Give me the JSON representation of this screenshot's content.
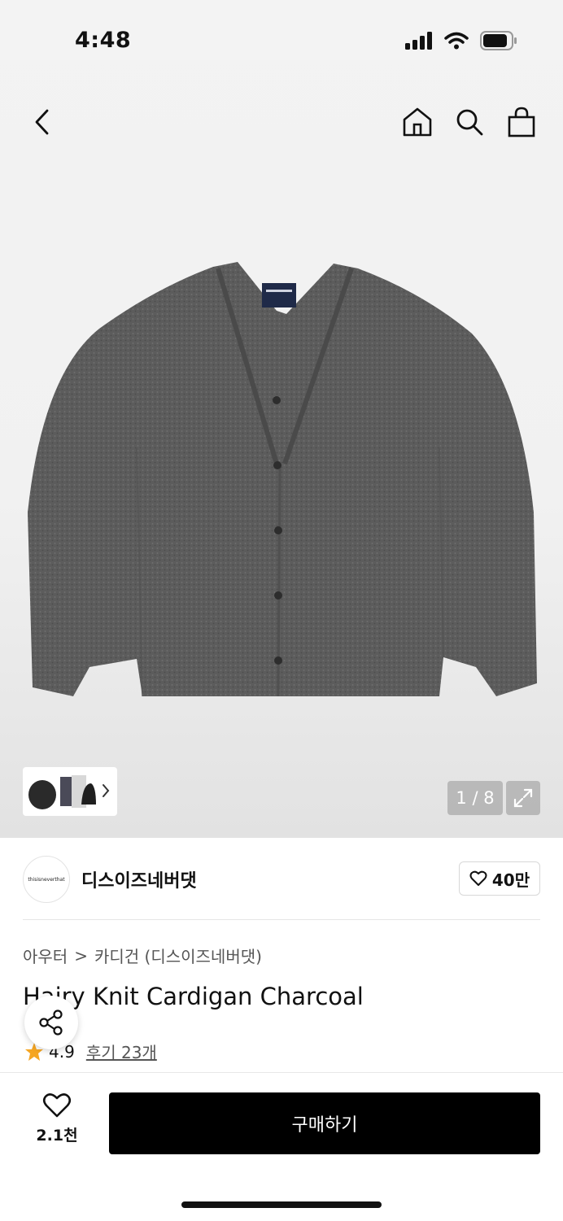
{
  "status_bar": {
    "time": "4:48"
  },
  "top_nav": {
    "back_icon": "chevron-left",
    "home_icon": "home",
    "search_icon": "search",
    "cart_icon": "shopping-bag"
  },
  "gallery": {
    "pager_text": "1 / 8",
    "expand_icon": "expand",
    "thumbnail_icon": "chevron-right"
  },
  "brand": {
    "logo_text": "thisisneverthat",
    "name": "디스이즈네버댓",
    "fav_count": "40만"
  },
  "breadcrumb": {
    "level1": "아우터",
    "separator": ">",
    "level2": "카디건 (디스이즈네버댓)"
  },
  "product": {
    "title": "Hairy Knit Cardigan Charcoal",
    "rating": "4.9",
    "review_text": "후기 23개"
  },
  "bottom_bar": {
    "like_count": "2.1천",
    "buy_label": "구매하기"
  },
  "colors": {
    "star": "#f5a623",
    "button": "#000000",
    "cardigan": "#5c5c5c"
  }
}
